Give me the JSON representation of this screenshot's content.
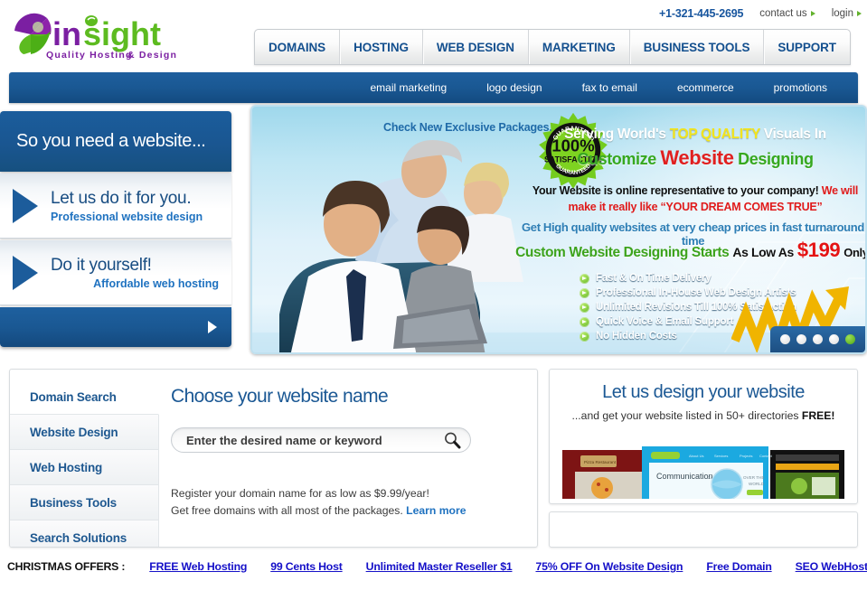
{
  "header": {
    "logo": {
      "word_in": "in",
      "word_sight": "sight",
      "tagline_left": "Quality Hosting",
      "tagline_right": "& Design"
    },
    "phone": "+1-321-445-2695",
    "contact_us": "contact us",
    "login": "login",
    "main_nav": [
      "DOMAINS",
      "HOSTING",
      "WEB DESIGN",
      "MARKETING",
      "BUSINESS TOOLS",
      "SUPPORT"
    ],
    "sub_nav": [
      "email marketing",
      "logo design",
      "fax to email",
      "ecommerce",
      "promotions"
    ]
  },
  "left_panel": {
    "heading": "So you need a website...",
    "options": [
      {
        "title": "Let us do it for you.",
        "subtitle": "Professional website design"
      },
      {
        "title": "Do it yourself!",
        "subtitle": "Affordable web hosting"
      }
    ]
  },
  "banner": {
    "check_packages": "Check New Exclusive Packages...",
    "seal": {
      "top": "GUARANTEED",
      "percent": "100%",
      "middle": "SATISFACTION",
      "bottom": "GUARANTEED"
    },
    "line1_a": "Serving World's ",
    "line1_b": "TOP QUALITY",
    "line1_c": " Visuals In",
    "line2_a": "Customize ",
    "line2_b": "Website",
    "line2_c": " Designing",
    "para_a": "Your Website is online representative to your company! ",
    "para_b": "We will",
    "para_c": "make it really like “YOUR DREAM COMES TRUE”",
    "para2": "Get High quality websites at very cheap prices in fast turnaround time",
    "para3_a": "Custom Website Designing Starts",
    "para3_b": "As Low As",
    "para3_price": "$199",
    "para3_c": "Only.",
    "bullets": [
      "Fast & On Time Delivery",
      "Professional In-House Web Design Artists",
      "Unlimited Revisions Till 100% Satisfaction",
      "Quick Voice & Email Support",
      "No Hidden Costs"
    ],
    "carousel_slides": 5,
    "carousel_active_index": 4
  },
  "domain_card": {
    "tabs": [
      "Domain Search",
      "Website Design",
      "Web Hosting",
      "Business Tools",
      "Search Solutions"
    ],
    "active_tab_index": 0,
    "heading": "Choose your website name",
    "search_placeholder": "Enter the desired name or keyword",
    "search_value": "",
    "note_line1": "Register your domain name for as low as $9.99/year!",
    "note_line2": "Get free domains with all most of the packages. ",
    "note_link": "Learn more"
  },
  "design_card": {
    "heading": "Let us design your website",
    "sub_a": "...and get your website listed in 50+ directories ",
    "sub_b": "FREE!",
    "thumb_site_title": "Communication",
    "thumb_site_sub": "co",
    "thumb_site_tag_1": "OVER THE",
    "thumb_site_tag_2": "WORLD",
    "thumb_restaurant": "Pizza Restaurant"
  },
  "offers_bar": {
    "label": "CHRISTMAS OFFERS :",
    "links": [
      "FREE Web Hosting",
      "99 Cents Host",
      "Unlimited Master Reseller $1",
      "75% OFF On Website Design",
      "Free Domain",
      "SEO WebHosting"
    ]
  },
  "colors": {
    "brand_blue": "#1b5894",
    "brand_purple": "#7b1fa2",
    "brand_green": "#5dbb20",
    "link_blue": "#1f72c0",
    "offer_link": "#1510c8",
    "accent_red": "#e01b1b",
    "accent_yellow": "#f2e41c"
  }
}
